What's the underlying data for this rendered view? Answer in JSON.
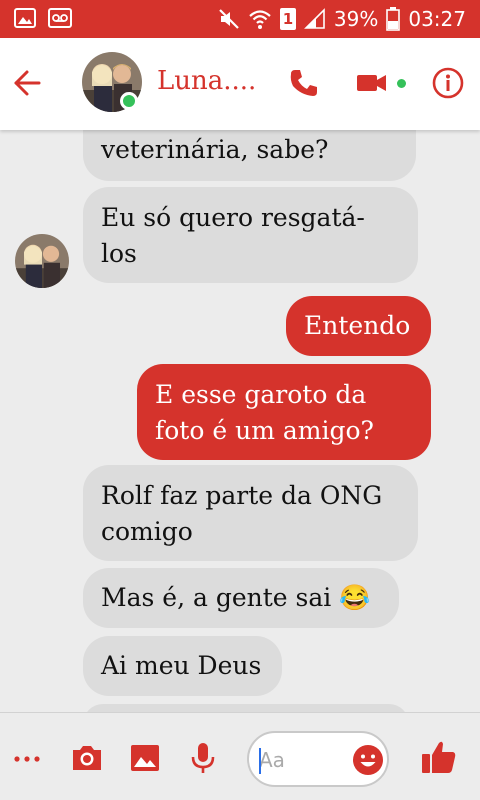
{
  "status_bar": {
    "battery": "39%",
    "time": "03:27",
    "sim_slot": "1"
  },
  "header": {
    "contact_name": "Luna...."
  },
  "messages": [
    {
      "direction": "received",
      "text": "veterinária, sabe?"
    },
    {
      "direction": "received",
      "text": "Eu só quero resgatá-\nlos"
    },
    {
      "direction": "sent",
      "text": "Entendo"
    },
    {
      "direction": "sent",
      "text": "E esse garoto da\nfoto é um amigo?"
    },
    {
      "direction": "received",
      "text": "Rolf faz parte da ONG\ncomigo"
    },
    {
      "direction": "received",
      "text": "Mas é, a gente sai 😂"
    },
    {
      "direction": "received",
      "text": "Ai meu Deus"
    }
  ],
  "composer": {
    "placeholder": "Aa"
  },
  "icons": {
    "status": [
      "image-icon",
      "voicemail-icon",
      "mute-icon",
      "wifi-icon",
      "signal-icon",
      "battery-icon"
    ],
    "header": [
      "back-arrow-icon",
      "phone-icon",
      "video-camera-icon",
      "info-icon"
    ],
    "bottom": [
      "more-icon",
      "camera-icon",
      "gallery-icon",
      "microphone-icon",
      "emoji-icon",
      "thumbs-up-icon"
    ]
  },
  "colors": {
    "accent": "#d5332c",
    "received_bubble": "#dcdcdc",
    "background": "#ececec",
    "online": "#35c15a"
  }
}
